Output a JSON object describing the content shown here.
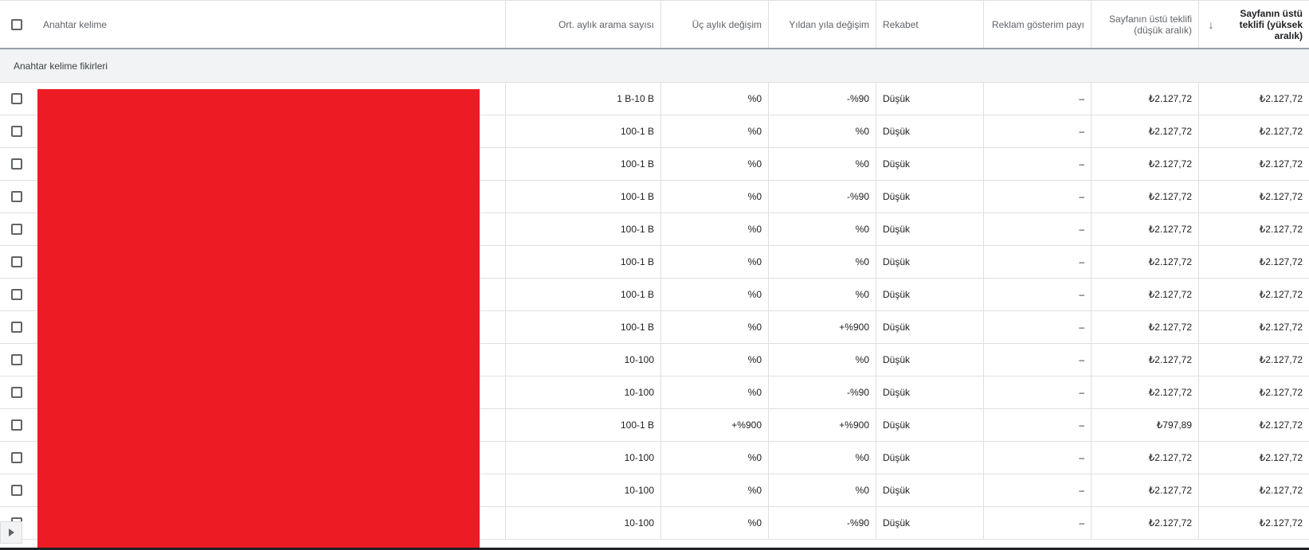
{
  "header": {
    "keyword": "Anahtar kelime",
    "avg_searches": "Ort. aylık arama sayısı",
    "three_month": "Üç aylık değişim",
    "yoy": "Yıldan yıla değişim",
    "competition": "Rekabet",
    "impr_share": "Reklam gösterim payı",
    "bid_low_line1": "Sayfanın üstü teklifi",
    "bid_low_line2": "(düşük aralık)",
    "sort_icon": "arrow-down-icon",
    "bid_high_line1": "Sayfanın üstü",
    "bid_high_line2": "teklifi (yüksek",
    "bid_high_line3": "aralık)"
  },
  "group_label": "Anahtar kelime fikirleri",
  "rows": [
    {
      "searches": "1 B-10 B",
      "three_month": "%0",
      "yoy": "-%90",
      "competition": "Düşük",
      "impr_share": "–",
      "bid_low": "₺2.127,72",
      "bid_high": "₺2.127,72"
    },
    {
      "searches": "100-1 B",
      "three_month": "%0",
      "yoy": "%0",
      "competition": "Düşük",
      "impr_share": "–",
      "bid_low": "₺2.127,72",
      "bid_high": "₺2.127,72"
    },
    {
      "searches": "100-1 B",
      "three_month": "%0",
      "yoy": "%0",
      "competition": "Düşük",
      "impr_share": "–",
      "bid_low": "₺2.127,72",
      "bid_high": "₺2.127,72"
    },
    {
      "searches": "100-1 B",
      "three_month": "%0",
      "yoy": "-%90",
      "competition": "Düşük",
      "impr_share": "–",
      "bid_low": "₺2.127,72",
      "bid_high": "₺2.127,72"
    },
    {
      "searches": "100-1 B",
      "three_month": "%0",
      "yoy": "%0",
      "competition": "Düşük",
      "impr_share": "–",
      "bid_low": "₺2.127,72",
      "bid_high": "₺2.127,72"
    },
    {
      "searches": "100-1 B",
      "three_month": "%0",
      "yoy": "%0",
      "competition": "Düşük",
      "impr_share": "–",
      "bid_low": "₺2.127,72",
      "bid_high": "₺2.127,72"
    },
    {
      "searches": "100-1 B",
      "three_month": "%0",
      "yoy": "%0",
      "competition": "Düşük",
      "impr_share": "–",
      "bid_low": "₺2.127,72",
      "bid_high": "₺2.127,72"
    },
    {
      "searches": "100-1 B",
      "three_month": "%0",
      "yoy": "+%900",
      "competition": "Düşük",
      "impr_share": "–",
      "bid_low": "₺2.127,72",
      "bid_high": "₺2.127,72"
    },
    {
      "searches": "10-100",
      "three_month": "%0",
      "yoy": "%0",
      "competition": "Düşük",
      "impr_share": "–",
      "bid_low": "₺2.127,72",
      "bid_high": "₺2.127,72"
    },
    {
      "searches": "10-100",
      "three_month": "%0",
      "yoy": "-%90",
      "competition": "Düşük",
      "impr_share": "–",
      "bid_low": "₺2.127,72",
      "bid_high": "₺2.127,72"
    },
    {
      "searches": "100-1 B",
      "three_month": "+%900",
      "yoy": "+%900",
      "competition": "Düşük",
      "impr_share": "–",
      "bid_low": "₺797,89",
      "bid_high": "₺2.127,72"
    },
    {
      "searches": "10-100",
      "three_month": "%0",
      "yoy": "%0",
      "competition": "Düşük",
      "impr_share": "–",
      "bid_low": "₺2.127,72",
      "bid_high": "₺2.127,72"
    },
    {
      "searches": "10-100",
      "three_month": "%0",
      "yoy": "%0",
      "competition": "Düşük",
      "impr_share": "–",
      "bid_low": "₺2.127,72",
      "bid_high": "₺2.127,72"
    },
    {
      "searches": "10-100",
      "three_month": "%0",
      "yoy": "-%90",
      "competition": "Düşük",
      "impr_share": "–",
      "bid_low": "₺2.127,72",
      "bid_high": "₺2.127,72"
    }
  ],
  "colors": {
    "redaction": "#ed1c24",
    "group_bg": "#f1f3f4"
  }
}
